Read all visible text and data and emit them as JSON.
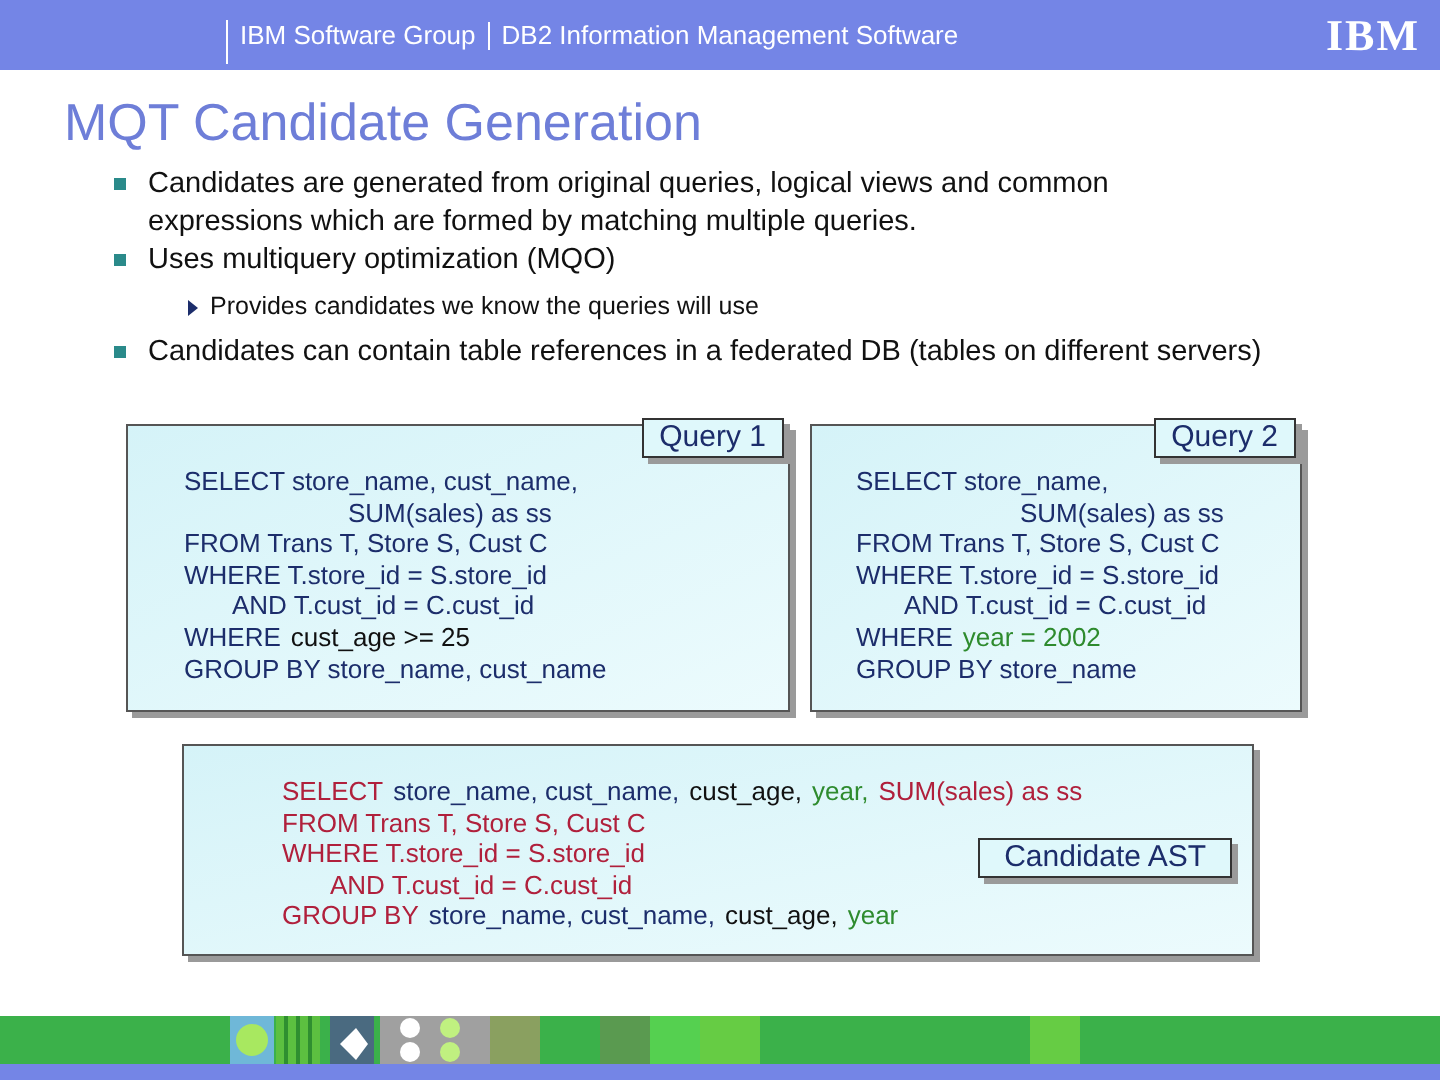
{
  "header": {
    "group": "IBM Software Group",
    "product": "DB2 Information Management Software",
    "logo": "IBM"
  },
  "title": "MQT Candidate Generation",
  "bullets": [
    {
      "text": "Candidates are generated from original queries, logical views and common expressions which are formed by matching multiple queries."
    },
    {
      "text": "Uses multiquery optimization (MQO)",
      "children": [
        {
          "text": "Provides candidates we know the queries will use"
        }
      ]
    },
    {
      "text": "Candidates can contain table references in a federated DB (tables on different servers)"
    }
  ],
  "queries": [
    {
      "label": "Query 1",
      "lines": [
        {
          "kind": "line",
          "parts": [
            {
              "text": "SELECT store_name, cust_name,",
              "color": "#1c2d6b"
            }
          ]
        },
        {
          "kind": "wrap",
          "parts": [
            {
              "text": "SUM(sales) as ss",
              "color": "#1c2d6b"
            }
          ]
        },
        {
          "kind": "line",
          "parts": [
            {
              "text": "FROM Trans T, Store S, Cust C",
              "color": "#1c2d6b"
            }
          ]
        },
        {
          "kind": "line",
          "parts": [
            {
              "text": "WHERE T.store_id = S.store_id",
              "color": "#1c2d6b"
            }
          ]
        },
        {
          "kind": "sub",
          "parts": [
            {
              "text": "AND T.cust_id = C.cust_id",
              "color": "#1c2d6b"
            }
          ]
        },
        {
          "kind": "line",
          "parts": [
            {
              "text": "WHERE",
              "color": "#1c2d6b"
            },
            {
              "text": "cust_age >= 25",
              "color": "#111111"
            }
          ]
        },
        {
          "kind": "line",
          "parts": [
            {
              "text": "GROUP BY store_name, cust_name",
              "color": "#1c2d6b"
            }
          ]
        }
      ]
    },
    {
      "label": "Query 2",
      "lines": [
        {
          "kind": "line",
          "parts": [
            {
              "text": "SELECT store_name,",
              "color": "#1c2d6b"
            }
          ]
        },
        {
          "kind": "wrap",
          "parts": [
            {
              "text": "SUM(sales) as ss",
              "color": "#1c2d6b"
            }
          ]
        },
        {
          "kind": "line",
          "parts": [
            {
              "text": "FROM Trans T, Store S, Cust C",
              "color": "#1c2d6b"
            }
          ]
        },
        {
          "kind": "line",
          "parts": [
            {
              "text": "WHERE T.store_id = S.store_id",
              "color": "#1c2d6b"
            }
          ]
        },
        {
          "kind": "sub",
          "parts": [
            {
              "text": "AND T.cust_id = C.cust_id",
              "color": "#1c2d6b"
            }
          ]
        },
        {
          "kind": "line",
          "parts": [
            {
              "text": "WHERE",
              "color": "#1c2d6b"
            },
            {
              "text": "year = 2002",
              "color": "#2e8b2e"
            }
          ]
        },
        {
          "kind": "line",
          "parts": [
            {
              "text": "GROUP BY store_name",
              "color": "#1c2d6b"
            }
          ]
        }
      ]
    }
  ],
  "candidate": {
    "label": "Candidate AST",
    "lines": [
      {
        "kind": "line",
        "parts": [
          {
            "text": "SELECT",
            "color": "#b0203c"
          },
          {
            "text": "store_name, cust_name,",
            "color": "#1c2d6b"
          },
          {
            "text": "cust_age,",
            "color": "#111111"
          },
          {
            "text": "year,",
            "color": "#2e8b2e"
          },
          {
            "text": "SUM(sales) as ss",
            "color": "#b0203c"
          }
        ]
      },
      {
        "kind": "line",
        "parts": [
          {
            "text": "FROM Trans T, Store S, Cust C",
            "color": "#b0203c"
          }
        ]
      },
      {
        "kind": "line",
        "parts": [
          {
            "text": "WHERE T.store_id = S.store_id",
            "color": "#b0203c"
          }
        ]
      },
      {
        "kind": "sub",
        "parts": [
          {
            "text": "AND T.cust_id = C.cust_id",
            "color": "#b0203c"
          }
        ]
      },
      {
        "kind": "line",
        "parts": [
          {
            "text": "GROUP BY",
            "color": "#b0203c"
          },
          {
            "text": "store_name, cust_name,",
            "color": "#1c2d6b"
          },
          {
            "text": "cust_age,",
            "color": "#111111"
          },
          {
            "text": "year",
            "color": "#2e8b2e"
          }
        ]
      }
    ]
  }
}
